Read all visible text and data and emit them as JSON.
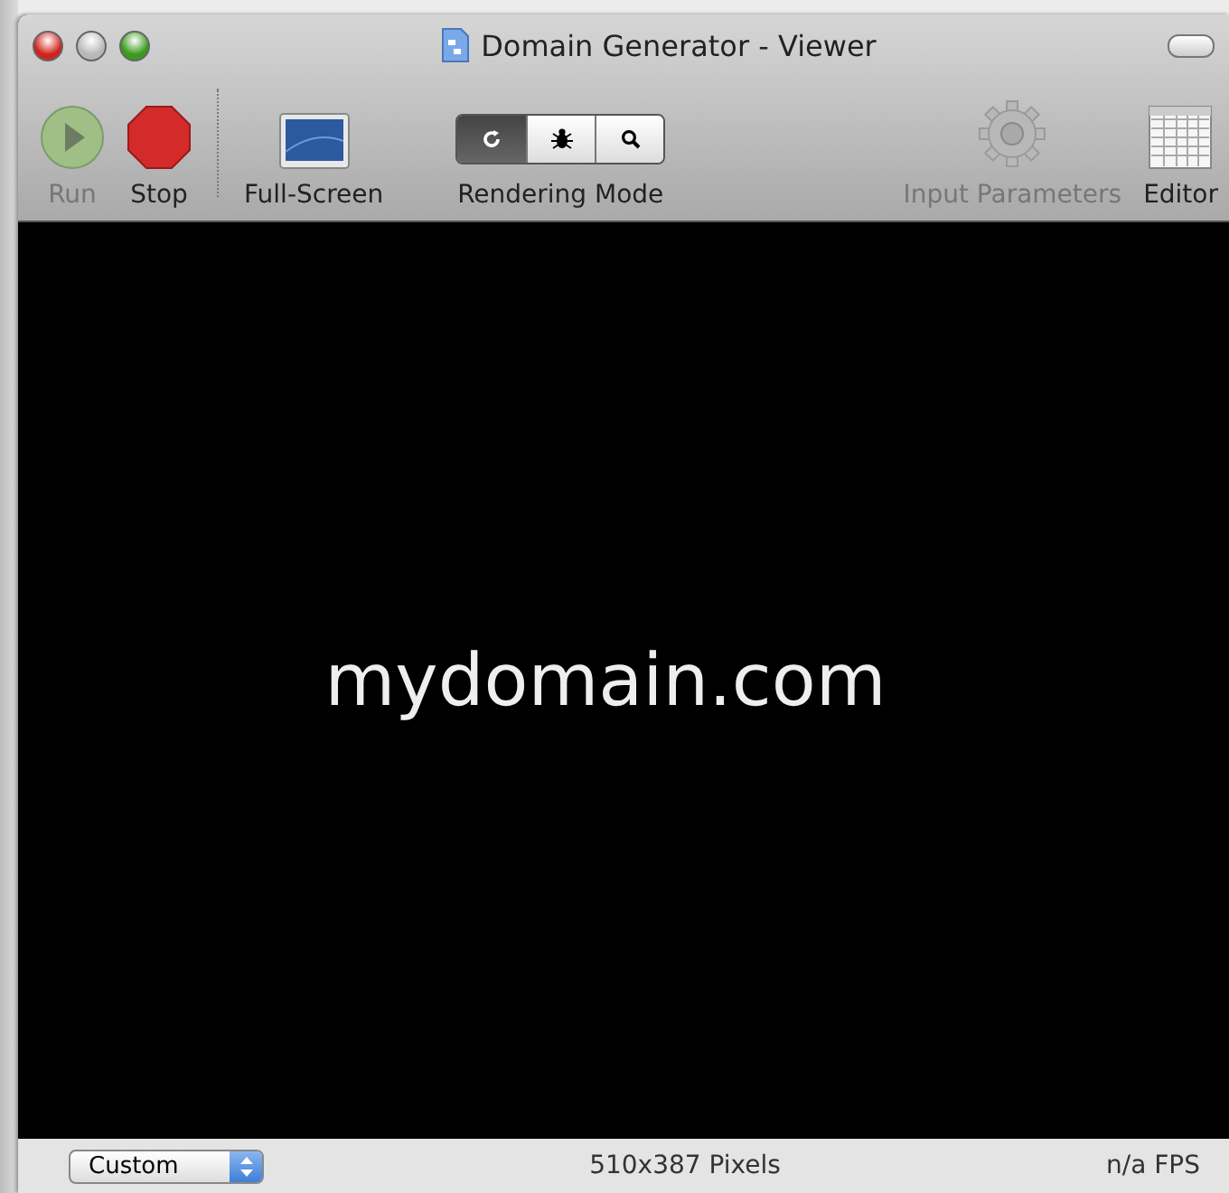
{
  "window": {
    "title": "Domain Generator - Viewer"
  },
  "toolbar": {
    "items": [
      {
        "kind": "run",
        "label": "Run",
        "disabled": true
      },
      {
        "kind": "stop",
        "label": "Stop",
        "disabled": false
      },
      {
        "kind": "separator"
      },
      {
        "kind": "fullscreen",
        "label": "Full-Screen",
        "disabled": false
      },
      {
        "kind": "segments",
        "label": "Rendering Mode",
        "segments": [
          {
            "selected": true
          },
          {
            "selected": false
          },
          {
            "selected": false
          }
        ]
      },
      {
        "kind": "spacer"
      },
      {
        "kind": "gear",
        "label": "Input Parameters",
        "disabled": true
      },
      {
        "kind": "editor",
        "label": "Editor",
        "disabled": false
      }
    ]
  },
  "viewer": {
    "text": "mydomain.com"
  },
  "status_bar": {
    "size_popup": "Custom",
    "dimensions": "510x387 Pixels",
    "fps": "n/a FPS"
  }
}
